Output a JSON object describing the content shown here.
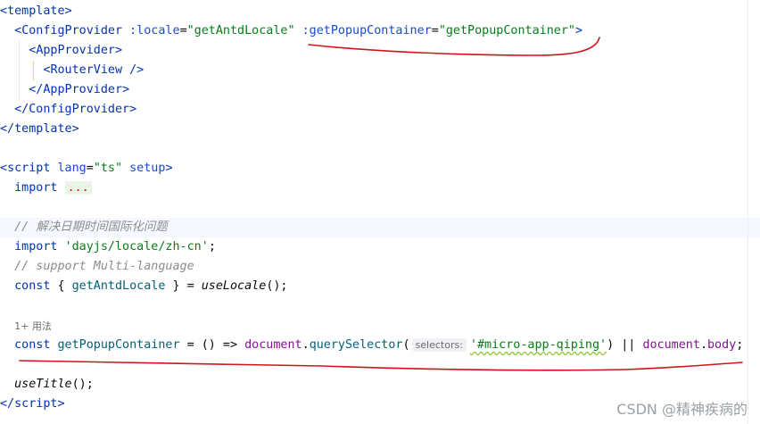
{
  "editor": {
    "l1": {
      "open": "<",
      "tag": "template",
      "close": ">"
    },
    "l2": {
      "open": "<",
      "tag": "ConfigProvider",
      "attr1": " :locale",
      "eq1": "=",
      "val1": "\"getAntdLocale\"",
      "attr2": " :getPopupContainer",
      "eq2": "=",
      "val2": "\"getPopupContainer\"",
      "close": ">"
    },
    "l3": {
      "open": "<",
      "tag": "AppProvider",
      "close": ">"
    },
    "l4": {
      "open": "<",
      "tag": "RouterView",
      "close": " />"
    },
    "l5": {
      "open": "</",
      "tag": "AppProvider",
      "close": ">"
    },
    "l6": {
      "open": "</",
      "tag": "ConfigProvider",
      "close": ">"
    },
    "l7": {
      "open": "</",
      "tag": "template",
      "close": ">"
    },
    "l9": {
      "open": "<",
      "tag": "script",
      "attr1": " lang",
      "eq1": "=",
      "val1": "\"ts\"",
      "attr2": " setup",
      "close": ">"
    },
    "l10": {
      "kw": "import",
      "fold": "..."
    },
    "l12": {
      "comment": "// 解决日期时间国际化问题"
    },
    "l13": {
      "kw": "import",
      "str": "'dayjs/locale/zh-cn'",
      "end": ";"
    },
    "l14": {
      "comment": "// support Multi-language"
    },
    "l15": {
      "kw": "const",
      "p1": " { ",
      "fn": "getAntdLocale",
      "p2": " } = ",
      "call": "useLocale",
      "end": "();"
    },
    "l16": {
      "usage": "1+ 用法"
    },
    "l17": {
      "kw": "const",
      "fn": " getPopupContainer",
      "p1": " = () => ",
      "g1": "document",
      "dot1": ".",
      "m1": "querySelector",
      "paren": "(",
      "hint": "selectors:",
      "str": "'#micro-app-qiping'",
      "p2": ") || ",
      "g2": "document",
      "dot2": ".",
      "m2": "body",
      "end": ";"
    },
    "l19": {
      "call": "useTitle",
      "end": "();"
    },
    "l20": {
      "open": "</",
      "tag": "script",
      "close": ">"
    }
  },
  "watermark": "CSDN @精神疾病的",
  "colors": {
    "annotation_red": "#d0141a",
    "tag": "#0033b3",
    "string": "#067d17",
    "comment": "#8c8c8c"
  }
}
